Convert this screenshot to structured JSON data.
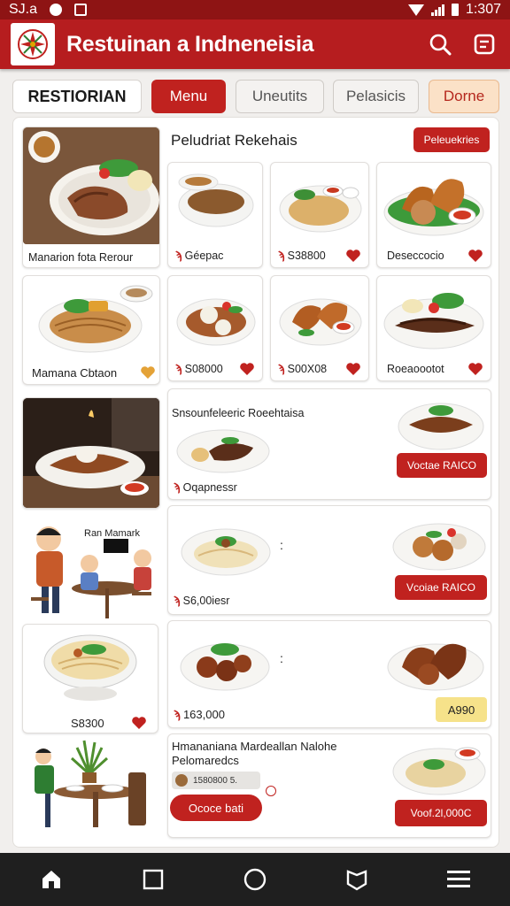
{
  "status_bar": {
    "left": "SJ.a",
    "time": "1:307"
  },
  "app_bar": {
    "title": "Restuinan a Indneneisia",
    "logo": "restaurant-emblem-icon"
  },
  "tabs": [
    {
      "label": "RESTIORIAN"
    },
    {
      "label": "Menu",
      "active": true
    },
    {
      "label": "Uneutits"
    },
    {
      "label": "Pelasicis"
    },
    {
      "label": "Dorne"
    }
  ],
  "section": {
    "title": "Peludriat Rekehais",
    "badge_button": "Peleuekries"
  },
  "cards": {
    "left1_caption": "Manarion fota Rerour",
    "left2_caption": "Mamana Cbtaon",
    "grid1": [
      {
        "price_marker": "ϡ",
        "price": "Géepac"
      },
      {
        "price_marker": "ϡ",
        "price": "S38800"
      },
      {
        "price_marker": "",
        "price": "Deseccocio"
      }
    ],
    "grid2": [
      {
        "price_marker": "ϡ",
        "price": "S08000"
      },
      {
        "price_marker": "ϡ",
        "price": "S00X08"
      },
      {
        "price_marker": "",
        "price": "Roeaoootot"
      }
    ],
    "wide1": {
      "title": "Snsounfeleeric Roeehtaisa",
      "price_marker": "ϡ",
      "price": "Oqapnessr",
      "button": "Voctae RAICO"
    },
    "wide2": {
      "price_marker": "ϡ",
      "price": "S6,00iesr",
      "button": "Vcoiae RAICO"
    },
    "bowl_price": "S8300",
    "wide3": {
      "price_marker": "ϡ",
      "price": "163,000",
      "tag": "A990"
    },
    "wide4": {
      "title_line1": "Hmananiana Mardeallan Nalohe",
      "title_line2": "Pelomaredcs",
      "qty_text": "1580800 5.",
      "order_button": "Ococe bati",
      "button": "Voof.2l,000C"
    },
    "dine_sign": "Ran Mamark"
  },
  "colors": {
    "brand_red": "#b61d1f",
    "accent_red": "#c0221f",
    "tag_yellow": "#f6e28a"
  }
}
